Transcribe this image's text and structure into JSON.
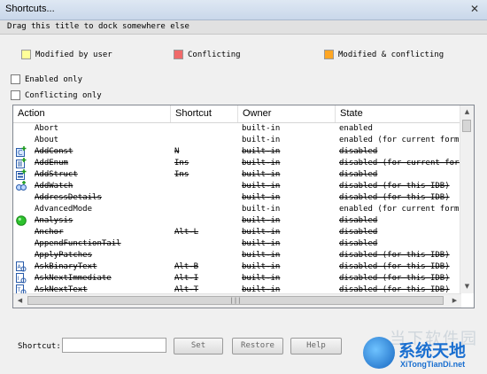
{
  "window": {
    "title": "Shortcuts...",
    "close_glyph": "✕"
  },
  "dock_hint": "Drag this title to dock somewhere else",
  "legend": [
    {
      "label": "Modified by user",
      "color": "#ffff99"
    },
    {
      "label": "Conflicting",
      "color": "#f06a6a"
    },
    {
      "label": "Modified & conflicting",
      "color": "#ffa623"
    }
  ],
  "filters": {
    "enabled_only": {
      "label": "Enabled only",
      "checked": false
    },
    "conflicting_only": {
      "label": "Conflicting only",
      "checked": false
    }
  },
  "table": {
    "columns": [
      "Action",
      "Shortcut",
      "Owner",
      "State"
    ],
    "rows": [
      {
        "action": "Abort",
        "shortcut": "",
        "owner": "built-in",
        "state": "enabled",
        "struck": false,
        "icon": ""
      },
      {
        "action": "About",
        "shortcut": "",
        "owner": "built-in",
        "state": "enabled (for current form)",
        "struck": false,
        "icon": ""
      },
      {
        "action": "AddConst",
        "shortcut": "N",
        "owner": "built-in",
        "state": "disabled",
        "struck": true,
        "icon": "add-const-icon"
      },
      {
        "action": "AddEnum",
        "shortcut": "Ins",
        "owner": "built-in",
        "state": "disabled (for current form)",
        "struck": true,
        "icon": "add-enum-icon"
      },
      {
        "action": "AddStruct",
        "shortcut": "Ins",
        "owner": "built-in",
        "state": "disabled",
        "struck": true,
        "icon": "add-struct-icon"
      },
      {
        "action": "AddWatch",
        "shortcut": "",
        "owner": "built-in",
        "state": "disabled (for this IDB)",
        "struck": true,
        "icon": "add-watch-icon"
      },
      {
        "action": "AddressDetails",
        "shortcut": "",
        "owner": "built-in",
        "state": "disabled (for this IDB)",
        "struck": true,
        "icon": ""
      },
      {
        "action": "AdvancedMode",
        "shortcut": "",
        "owner": "built-in",
        "state": "enabled (for current form)",
        "struck": false,
        "icon": ""
      },
      {
        "action": "Analysis",
        "shortcut": "",
        "owner": "built-in",
        "state": "disabled",
        "struck": true,
        "icon": "analysis-icon"
      },
      {
        "action": "Anchor",
        "shortcut": "Alt-L",
        "owner": "built-in",
        "state": "disabled",
        "struck": true,
        "icon": ""
      },
      {
        "action": "AppendFunctionTail",
        "shortcut": "",
        "owner": "built-in",
        "state": "disabled",
        "struck": true,
        "icon": ""
      },
      {
        "action": "ApplyPatches",
        "shortcut": "",
        "owner": "built-in",
        "state": "disabled (for this IDB)",
        "struck": true,
        "icon": ""
      },
      {
        "action": "AskBinaryText",
        "shortcut": "Alt-B",
        "owner": "built-in",
        "state": "disabled (for this IDB)",
        "struck": true,
        "icon": "ask-binary-text-icon"
      },
      {
        "action": "AskNextImmediate",
        "shortcut": "Alt-I",
        "owner": "built-in",
        "state": "disabled (for this IDB)",
        "struck": true,
        "icon": "ask-next-immediate-icon"
      },
      {
        "action": "AskNextText",
        "shortcut": "Alt-T",
        "owner": "built-in",
        "state": "disabled (for this IDB)",
        "struck": true,
        "icon": "ask-next-text-icon"
      }
    ]
  },
  "scroll_grip": "|||",
  "footer": {
    "shortcut_label": "Shortcut:",
    "shortcut_value": "",
    "buttons": {
      "set": "Set",
      "restore": "Restore",
      "help": "Help"
    }
  },
  "watermark": {
    "ghost": "当下软件园",
    "cn": "系统天地",
    "url": "XiTongTianDi.net"
  }
}
